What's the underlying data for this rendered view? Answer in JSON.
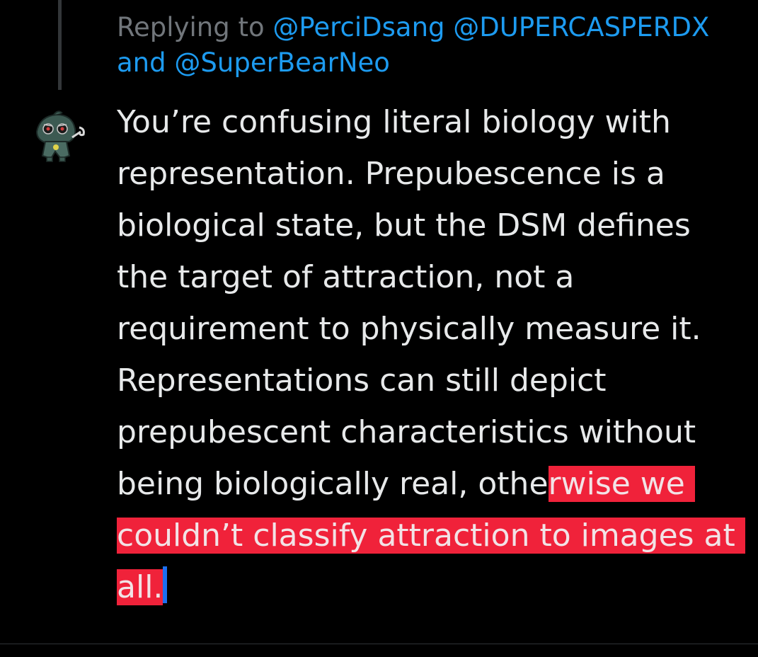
{
  "reply_context": {
    "prefix": "Replying to",
    "mention_1": "@PerciDsang",
    "mention_2": "@DUPERCASPERDX",
    "and_word": "and",
    "mention_3": "@SuperBearNeo"
  },
  "tweet": {
    "text_unhighlighted": "You’re confusing literal biology with representation. Prepubescence is a biological state, but the DSM defines the target of attraction, not a requirement to physically measure it. Representations can still depict prepubescent characteristics without being biologically real, othe",
    "text_highlighted": "rwise we couldn’t classify attraction to images at all."
  },
  "avatar": {
    "icon": "cartoon-creature-avatar-icon"
  },
  "colors": {
    "background": "#000000",
    "text": "#e7e9ea",
    "muted": "#71767b",
    "link": "#1d9bf0",
    "highlight": "#f0223a",
    "caret": "#1d6ff0"
  }
}
